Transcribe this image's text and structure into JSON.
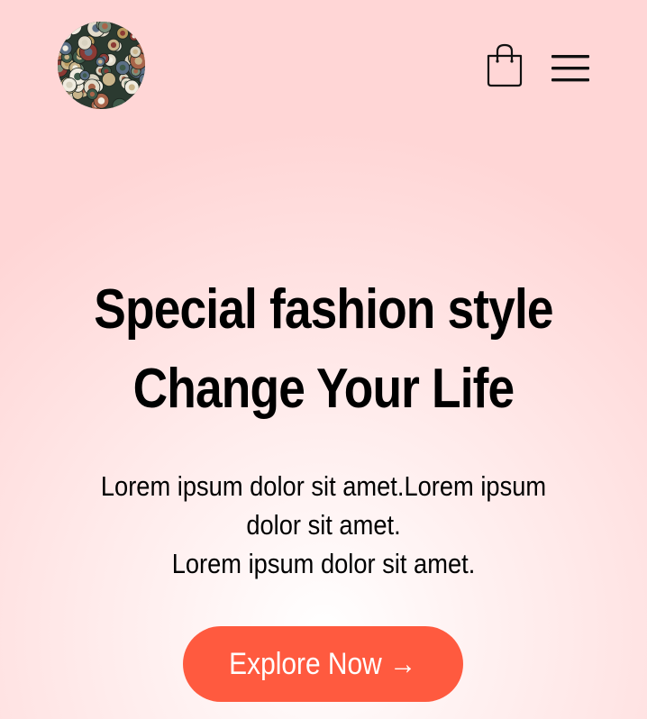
{
  "header": {
    "logo_alt": "brand logo",
    "bag_icon": "shopping-bag-icon",
    "menu_icon": "hamburger-menu-icon"
  },
  "hero": {
    "title_line1": "Special fashion style",
    "title_line2": "Change Your Life",
    "text_line1": "Lorem ipsum dolor sit amet.Lorem ipsum",
    "text_line2": "dolor sit amet.",
    "text_line3": "Lorem ipsum dolor sit amet.",
    "cta_label": "Explore Now",
    "cta_arrow": "→"
  },
  "colors": {
    "accent": "#ff5a3f",
    "background_edge": "#ffd6d6",
    "background_center": "#ffffff",
    "text": "#000000"
  }
}
